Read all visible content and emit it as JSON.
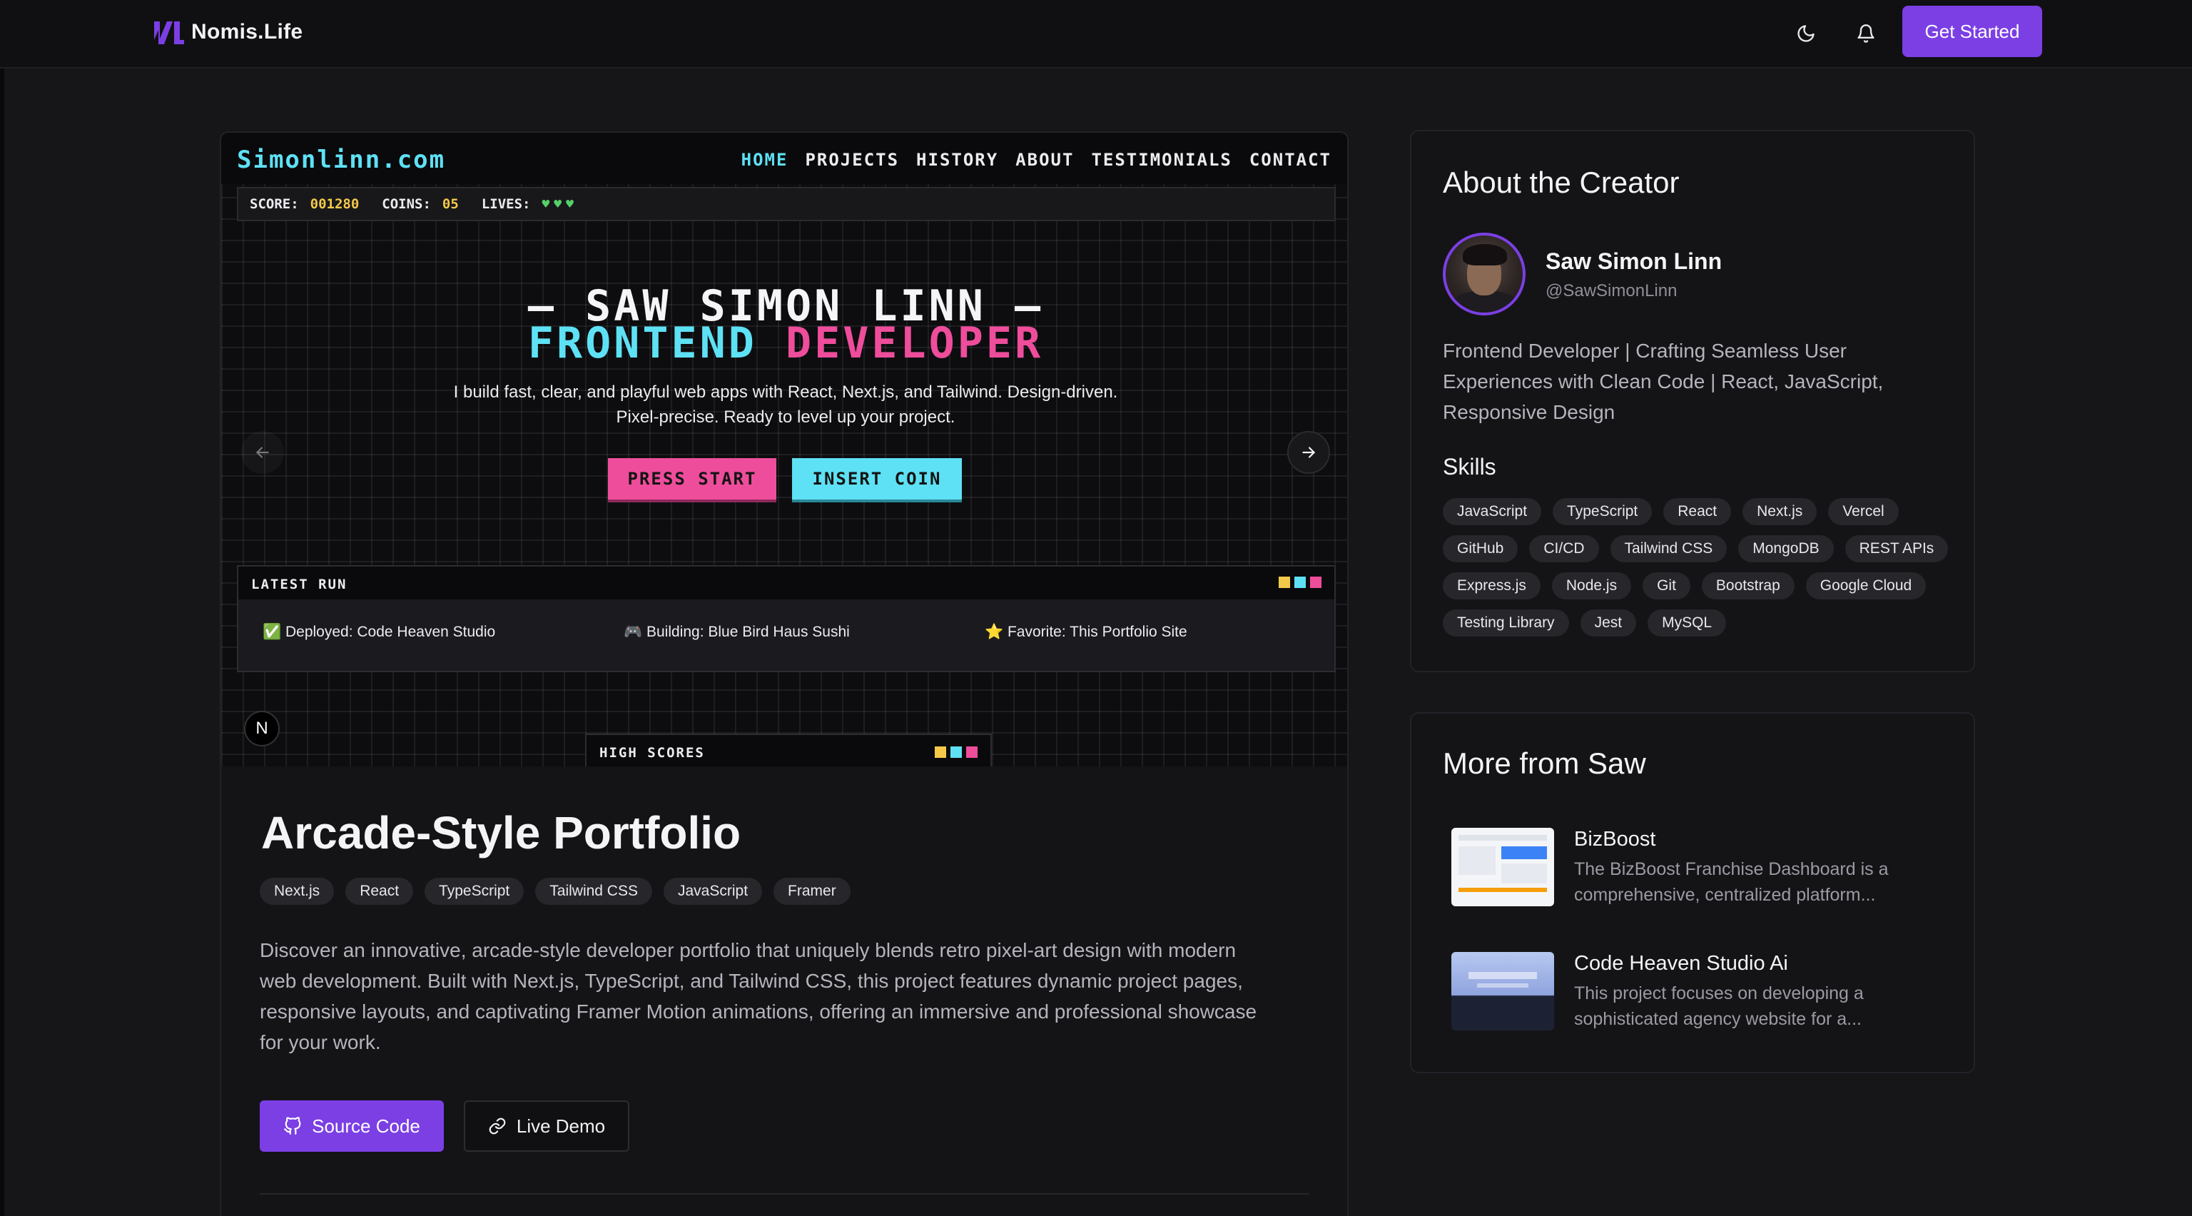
{
  "header": {
    "logo_text": "Nomis.Life",
    "cta_label": "Get Started",
    "icons": [
      "moon-icon",
      "bell-icon"
    ]
  },
  "preview": {
    "brand": "Simonlinn.com",
    "menu": [
      "HOME",
      "PROJECTS",
      "HISTORY",
      "ABOUT",
      "TESTIMONIALS",
      "CONTACT"
    ],
    "hud": {
      "score_label": "SCORE:",
      "score_value": "001280",
      "coins_label": "COINS:",
      "coins_value": "05",
      "lives_label": "LIVES:",
      "lives": 3
    },
    "title_line1": "— SAW SIMON LINN —",
    "title_line2a": "FRONTEND",
    "title_line2b": "DEVELOPER",
    "subtitle": "I build fast, clear, and playful web apps with React, Next.js, and Tailwind. Design-driven. Pixel-precise. Ready to level up your project.",
    "btn_start": "PRESS START",
    "btn_coin": "INSERT COIN",
    "latest_run_label": "LATEST RUN",
    "runs": [
      "✅ Deployed: Code Heaven Studio",
      "🎮 Building: Blue Bird Haus Sushi",
      "⭐ Favorite: This Portfolio Site"
    ],
    "high_scores_label": "HIGH SCORES",
    "n_badge": "N"
  },
  "project": {
    "title": "Arcade-Style Portfolio",
    "tags": [
      "Next.js",
      "React",
      "TypeScript",
      "Tailwind CSS",
      "JavaScript",
      "Framer"
    ],
    "description": "Discover an innovative, arcade-style developer portfolio that uniquely blends retro pixel-art design with modern web development. Built with Next.js, TypeScript, and Tailwind CSS, this project features dynamic project pages, responsive layouts, and captivating Framer Motion animations, offering an immersive and professional showcase for your work.",
    "source_label": "Source Code",
    "demo_label": "Live Demo"
  },
  "about": {
    "heading": "About the Creator",
    "name": "Saw Simon Linn",
    "handle": "@SawSimonLinn",
    "bio": "Frontend Developer | Crafting Seamless User Experiences with Clean Code | React, JavaScript, Responsive Design",
    "skills_heading": "Skills",
    "skills": [
      "JavaScript",
      "TypeScript",
      "React",
      "Next.js",
      "Vercel",
      "GitHub",
      "CI/CD",
      "Tailwind CSS",
      "MongoDB",
      "REST APIs",
      "Express.js",
      "Node.js",
      "Git",
      "Bootstrap",
      "Google Cloud",
      "Testing Library",
      "Jest",
      "MySQL"
    ]
  },
  "more": {
    "heading": "More from Saw",
    "items": [
      {
        "title": "BizBoost",
        "desc": "The BizBoost Franchise Dashboard is a comprehensive, centralized platform..."
      },
      {
        "title": "Code Heaven Studio Ai",
        "desc": "This project focuses on developing a sophisticated agency website for a..."
      }
    ]
  }
}
